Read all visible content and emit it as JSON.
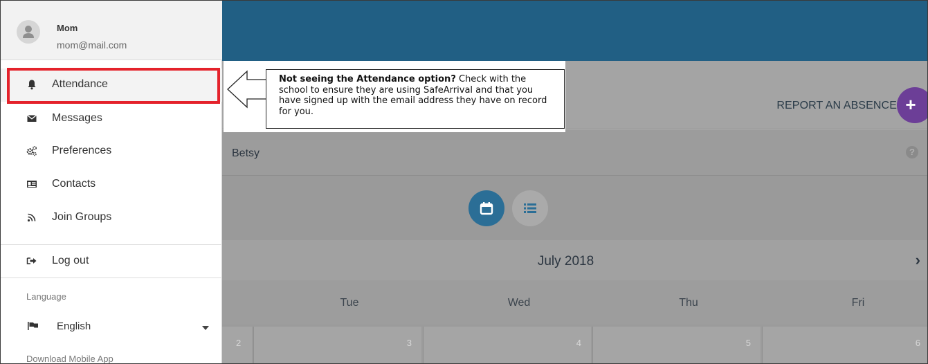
{
  "profile": {
    "name": "Mom",
    "email": "mom@mail.com",
    "avatar_icon": "person-avatar-icon"
  },
  "sidebar": {
    "items": [
      {
        "label": "Attendance",
        "icon": "bell-icon"
      },
      {
        "label": "Messages",
        "icon": "envelope-icon"
      },
      {
        "label": "Preferences",
        "icon": "gears-icon"
      },
      {
        "label": "Contacts",
        "icon": "id-card-icon"
      },
      {
        "label": "Join Groups",
        "icon": "rss-icon"
      },
      {
        "label": "Log out",
        "icon": "sign-out-icon"
      }
    ],
    "language_heading": "Language",
    "language_value": "English",
    "download_label": "Download Mobile App"
  },
  "callout": {
    "bold": "Not seeing the Attendance option?",
    "text_1": " Check with the school to ensure they are using SafeArrival and that you have signed up with the email address they have on record for you."
  },
  "main": {
    "report_label": "REPORT AN ABSENCE",
    "report_icon": "plus-icon",
    "student_name": "Betsy",
    "help_icon": "?",
    "month_title": "July 2018",
    "next_icon": "›",
    "weekdays": [
      "Tue",
      "Wed",
      "Thu",
      "Fri"
    ],
    "days": [
      "2",
      "3",
      "4",
      "5",
      "6"
    ]
  },
  "colors": {
    "header": "#215f84",
    "accent_purple": "#6c3e97",
    "highlight_red": "#e4222b",
    "calendar_button": "#2b6e96"
  }
}
